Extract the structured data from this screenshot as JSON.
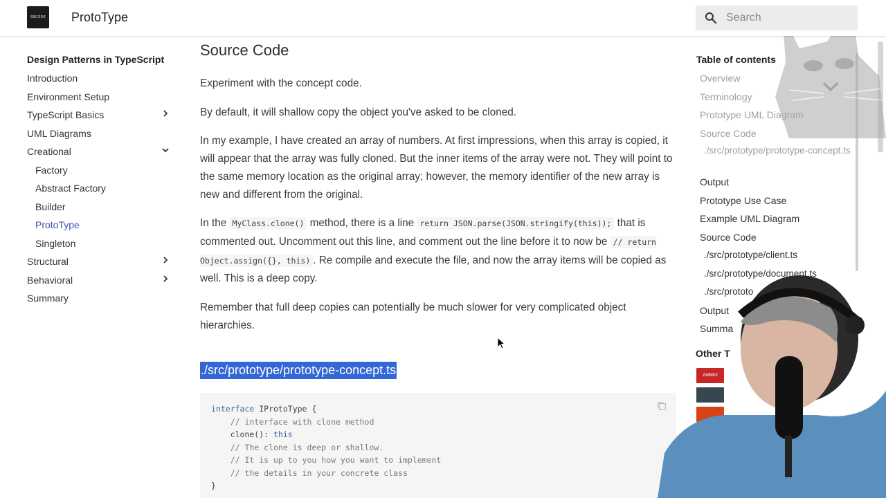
{
  "header": {
    "logo_text": "SBCODE",
    "title": "ProtoType",
    "search_placeholder": "Search"
  },
  "left_nav": {
    "heading": "Design Patterns in TypeScript",
    "items": [
      {
        "label": "Introduction"
      },
      {
        "label": "Environment Setup"
      },
      {
        "label": "TypeScript Basics",
        "chevron": "right"
      },
      {
        "label": "UML Diagrams"
      },
      {
        "label": "Creational",
        "chevron": "down"
      },
      {
        "label": "Factory",
        "sub": true
      },
      {
        "label": "Abstract Factory",
        "sub": true
      },
      {
        "label": "Builder",
        "sub": true
      },
      {
        "label": "ProtoType",
        "sub": true,
        "active": true
      },
      {
        "label": "Singleton",
        "sub": true
      },
      {
        "label": "Structural",
        "chevron": "right"
      },
      {
        "label": "Behavioral",
        "chevron": "right"
      },
      {
        "label": "Summary"
      }
    ]
  },
  "main": {
    "heading": "Source Code",
    "para1": "Experiment with the concept code.",
    "para2": "By default, it will shallow copy the object you've asked to be cloned.",
    "para3": "In my example, I have created an array of numbers. At first impressions, when this array is copied, it will appear that the array was fully cloned. But the inner items of the array were not. They will point to the same memory location as the original array; however, the memory identifier of the new array is new and different from the original.",
    "para4": {
      "t1": "In the ",
      "c1": "MyClass.clone()",
      "t2": " method, there is a line ",
      "c2": "return JSON.parse(JSON.stringify(this));",
      "t3": " that is commented out. Uncomment out this line, and comment out the line before it to now be ",
      "c3": "// return Object.assign({}, this)",
      "t4": ". Re compile and execute the file, and now the array items will be copied as well. This is a deep copy."
    },
    "para5": "Remember that full deep copies can potentially be much slower for very complicated object hierarchies.",
    "file_heading": "./src/prototype/prototype-concept.ts",
    "code": {
      "l1_kw": "interface",
      "l1_rest": " IProtoType {",
      "l2": "    // interface with clone method",
      "l3_a": "    clone(): ",
      "l3_kw": "this",
      "l4": "    // The clone is deep or shallow.",
      "l5": "    // It is up to you how you want to implement",
      "l6": "    // the details in your concrete class",
      "l7": "}"
    }
  },
  "toc": {
    "heading": "Table of contents",
    "items": [
      {
        "label": "Overview",
        "faded": true
      },
      {
        "label": "Terminology",
        "faded": true
      },
      {
        "label": "Prototype UML Diagram",
        "faded": true
      },
      {
        "label": "Source Code",
        "faded": true
      },
      {
        "label": "./src/prototype/prototype-concept.ts",
        "sub": true
      },
      {
        "label": "Output"
      },
      {
        "label": "Prototype Use Case"
      },
      {
        "label": "Example UML Diagram"
      },
      {
        "label": "Source Code"
      },
      {
        "label": "./src/prototype/client.ts",
        "sub": true
      },
      {
        "label": "./src/prototype/document.ts",
        "sub": true
      },
      {
        "label": "./src/prototo",
        "sub": true
      },
      {
        "label": "Output"
      },
      {
        "label": "Summa"
      }
    ],
    "other_heading": "Other T",
    "thumb_label": "ZABBIX"
  },
  "colors": {
    "accent": "#4051b5",
    "highlight": "#3367d6"
  }
}
